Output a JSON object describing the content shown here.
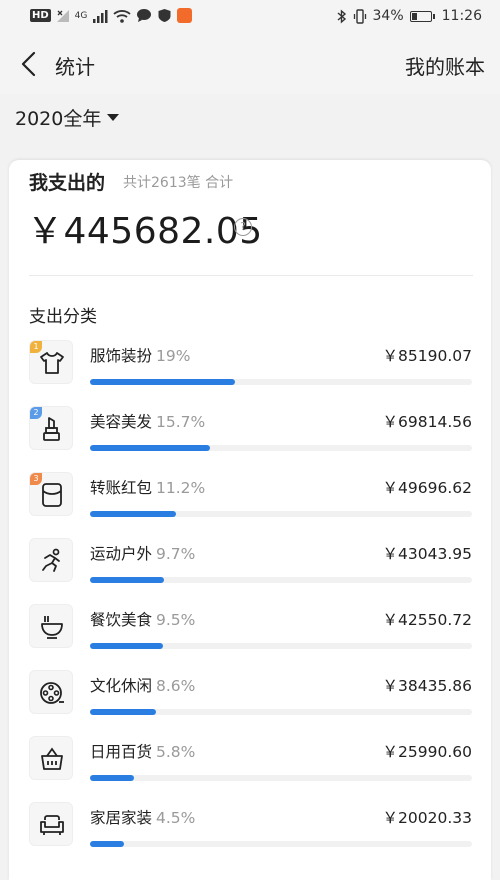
{
  "status_bar": {
    "network_chip": "HD",
    "signal_label": "4G",
    "battery_percent": "34%",
    "battery_level": 0.34,
    "time": "11:26"
  },
  "nav": {
    "title": "统计",
    "right_link": "我的账本"
  },
  "filter": {
    "year_label": "2020全年"
  },
  "summary": {
    "title": "我支出的",
    "subtitle": "共计2613笔 合计",
    "total": "￥445682.05",
    "help_glyph": "?"
  },
  "section_title": "支出分类",
  "colors": {
    "accent": "#2b7ee1",
    "rank1": "#f0b23c",
    "rank2": "#5b9be8",
    "rank3": "#f08a4b"
  },
  "categories": [
    {
      "name": "服饰装扮",
      "percent": "19%",
      "amount": "￥85190.07",
      "share": 19,
      "icon": "tshirt-icon",
      "rank": "1"
    },
    {
      "name": "美容美发",
      "percent": "15.7%",
      "amount": "￥69814.56",
      "share": 15.7,
      "icon": "lipstick-icon",
      "rank": "2"
    },
    {
      "name": "转账红包",
      "percent": "11.2%",
      "amount": "￥49696.62",
      "share": 11.2,
      "icon": "red-envelope-icon",
      "rank": "3"
    },
    {
      "name": "运动户外",
      "percent": "9.7%",
      "amount": "￥43043.95",
      "share": 9.7,
      "icon": "running-icon",
      "rank": ""
    },
    {
      "name": "餐饮美食",
      "percent": "9.5%",
      "amount": "￥42550.72",
      "share": 9.5,
      "icon": "bowl-icon",
      "rank": ""
    },
    {
      "name": "文化休闲",
      "percent": "8.6%",
      "amount": "￥38435.86",
      "share": 8.6,
      "icon": "film-reel-icon",
      "rank": ""
    },
    {
      "name": "日用百货",
      "percent": "5.8%",
      "amount": "￥25990.60",
      "share": 5.8,
      "icon": "basket-icon",
      "rank": ""
    },
    {
      "name": "家居家装",
      "percent": "4.5%",
      "amount": "￥20020.33",
      "share": 4.5,
      "icon": "sofa-icon",
      "rank": ""
    }
  ]
}
